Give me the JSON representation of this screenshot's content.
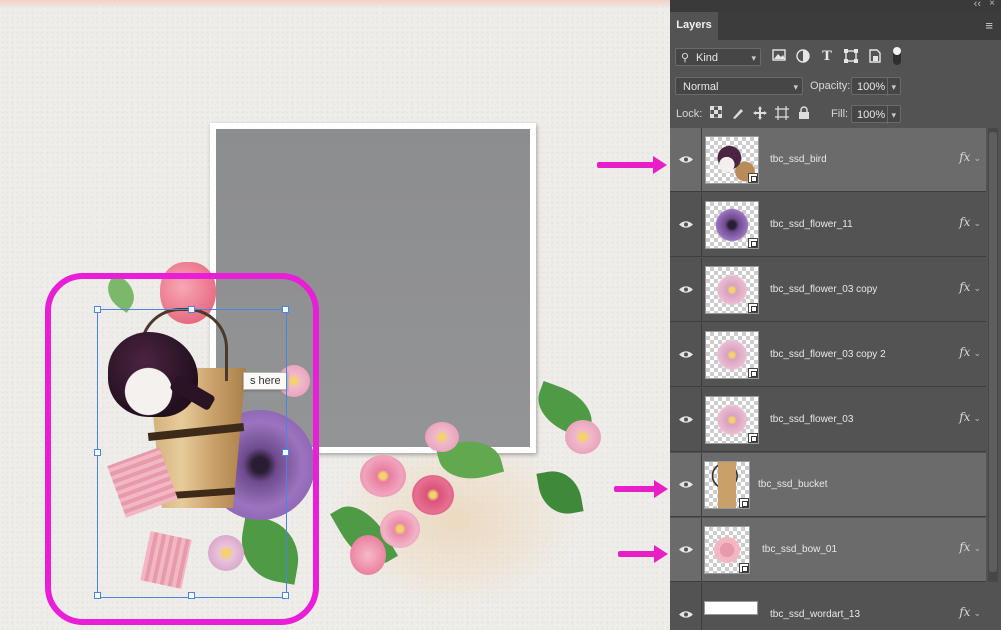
{
  "panel": {
    "tab_label": "Layers",
    "filter": {
      "kind_label": "Kind",
      "icons": [
        "image-filter-icon",
        "adjustment-filter-icon",
        "type-filter-icon",
        "shape-filter-icon",
        "smart-object-filter-icon"
      ]
    },
    "blend_mode": "Normal",
    "opacity_label": "Opacity:",
    "opacity_value": "100%",
    "lock_label": "Lock:",
    "fill_label": "Fill:",
    "fill_value": "100%"
  },
  "layers": [
    {
      "name": "tbc_ssd_bird",
      "selected": true,
      "fx": "fx",
      "thumb": "bird"
    },
    {
      "name": "tbc_ssd_flower_11",
      "selected": false,
      "fx": "fx",
      "thumb": "purple-flower"
    },
    {
      "name": "tbc_ssd_flower_03 copy",
      "selected": false,
      "fx": "fx",
      "thumb": "pink-flower"
    },
    {
      "name": "tbc_ssd_flower_03 copy 2",
      "selected": false,
      "fx": "fx",
      "thumb": "pink-flower"
    },
    {
      "name": "tbc_ssd_flower_03",
      "selected": false,
      "fx": "fx",
      "thumb": "pink-flower"
    },
    {
      "name": "tbc_ssd_bucket",
      "selected": true,
      "fx": "",
      "thumb": "bucket"
    },
    {
      "name": "tbc_ssd_bow_01",
      "selected": true,
      "fx": "fx",
      "thumb": "bow"
    },
    {
      "name": "tbc_ssd_wordart_13",
      "selected": false,
      "fx": "fx",
      "thumb": "wordart"
    }
  ],
  "canvas": {
    "label_text": "s here",
    "accent_color": "#e81fd6",
    "selection_color": "#4a86e0"
  }
}
